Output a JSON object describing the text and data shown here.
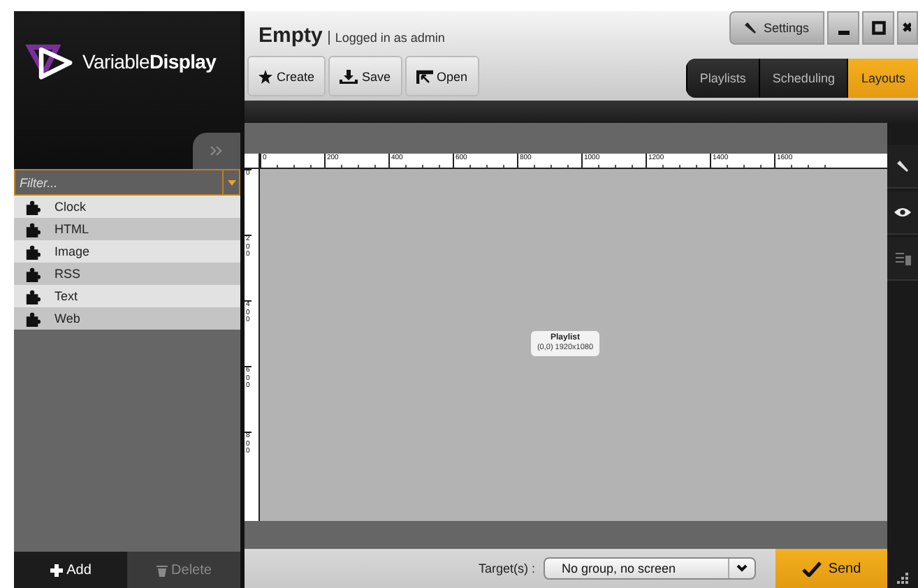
{
  "logo": {
    "text": "Variable**Display**"
  },
  "sidebar": {
    "filter": {
      "placeholder": "Filter..."
    },
    "items": [
      {
        "label": "Clock"
      },
      {
        "label": "HTML"
      },
      {
        "label": "Image"
      },
      {
        "label": "RSS"
      },
      {
        "label": "Text"
      },
      {
        "label": "Web"
      }
    ],
    "buttons": [
      {
        "label": "Add",
        "disabled": false
      },
      {
        "label": "Delete",
        "disabled": true
      }
    ]
  },
  "header": {
    "title": "Empty",
    "subtitle": "Logged in as admin",
    "actions": [
      {
        "label": "Create",
        "kind": "star"
      },
      {
        "label": "Save",
        "kind": "save"
      },
      {
        "label": "Open",
        "kind": "open"
      }
    ],
    "settings": "Settings",
    "tabs": [
      {
        "label": "Playlists",
        "selected": false
      },
      {
        "label": "Scheduling",
        "selected": false
      },
      {
        "label": "Layouts",
        "selected": true
      }
    ]
  },
  "ruler": {
    "x_labels": [
      "0",
      "200",
      "400",
      "600",
      "800",
      "1000",
      "1200",
      "1400",
      "1600"
    ],
    "y_labels": [
      "0",
      "200",
      "400",
      "600",
      "800"
    ]
  },
  "canvas": {
    "zone": {
      "title": "Playlist",
      "info": "(0,0) 1920x1080"
    }
  },
  "footer": {
    "target_label": "Target(s) :",
    "target_value": "No group, no screen",
    "send": "Send"
  }
}
